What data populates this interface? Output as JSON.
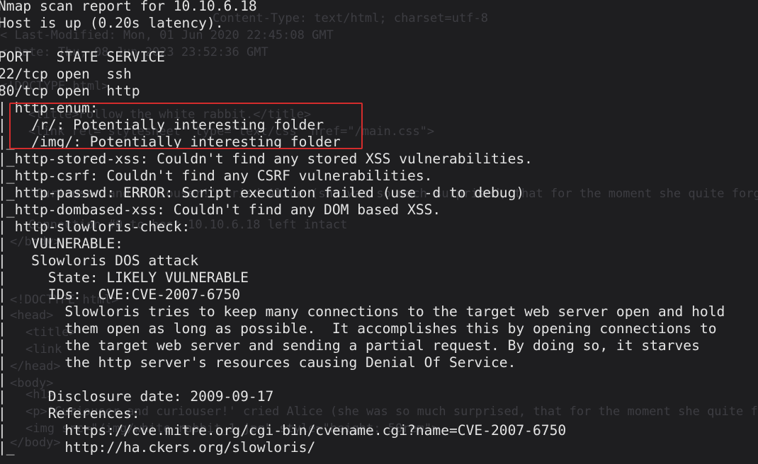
{
  "terminal": {
    "lines": [
      "Nmap scan report for 10.10.6.18",
      "Host is up (0.20s latency).",
      "",
      "PORT   STATE SERVICE",
      "22/tcp open  ssh",
      "80/tcp open  http",
      "| http-enum:",
      "|   /r/: Potentially interesting folder",
      "|_  /img/: Potentially interesting folder",
      "|_http-stored-xss: Couldn't find any stored XSS vulnerabilities.",
      "|_http-csrf: Couldn't find any CSRF vulnerabilities.",
      "|_http-passwd: ERROR: Script execution failed (use -d to debug)",
      "|_http-dombased-xss: Couldn't find any DOM based XSS.",
      "| http-slowloris-check:",
      "|   VULNERABLE:",
      "|   Slowloris DOS attack",
      "|     State: LIKELY VULNERABLE",
      "|     IDs:  CVE:CVE-2007-6750",
      "|       Slowloris tries to keep many connections to the target web server open and hold",
      "|       them open as long as possible.  It accomplishes this by opening connections to",
      "|       the target web server and sending a partial request. By doing so, it starves",
      "|       the http server's resources causing Denial Of Service.",
      "|",
      "|     Disclosure date: 2009-09-17",
      "|     References:",
      "|       https://cve.mitre.org/cgi-bin/cvename.cgi?name=CVE-2007-6750",
      "|_      http://ha.ckers.org/slowloris/"
    ]
  },
  "background_text": [
    "Content-Type: text/html; charset=utf-8",
    "< Last-Modified: Mon, 01 Jun 2020 22:45:08 GMT",
    "< Date: Thu, 08 Jun 2023 23:52:36 GMT",
    "<!DOCTYPE html>",
    "<title>Follow the white rabbit.</title>",
    "<link rel=\"stylesheet\" type=\"text/css\" href=\"/main.css\">",
    "'Curiouser and curiouser!' cried Alice (she was so much surprised, that for the moment she quite forgot",
    "Connection #0 to host 10.10.6.18 left intact",
    "</body>",
    "<!DOCTYPE html>",
    "<head>",
    "<title>",
    "<link",
    "</head>",
    "<body>",
    "<h1>",
    "<p>'Curiouser and curiouser!' cried Alice (she was so much surprised, that for the moment she quite forgot",
    "<img src=\"/img/white_rabbit_1.jpg\" style=\"height: 50rem\">",
    "</body>"
  ],
  "highlight": {
    "color": "#d42c2c"
  },
  "colors": {
    "background": "#1e1e20",
    "foreground": "#e4e4e4",
    "ghost_text": "#3d3d42"
  }
}
